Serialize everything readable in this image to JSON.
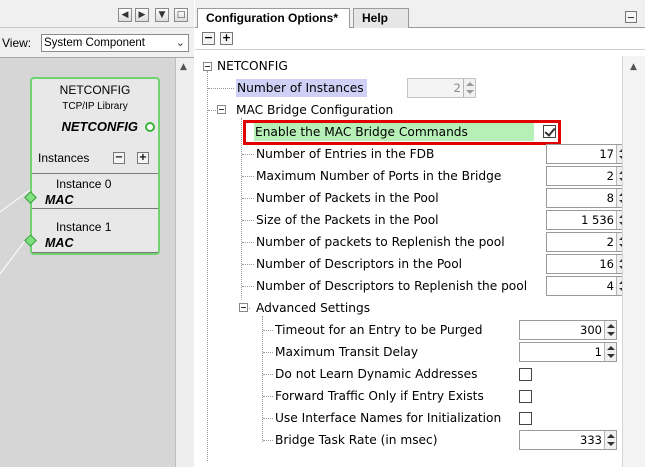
{
  "view": {
    "label": "View:",
    "selected": "System Component"
  },
  "component": {
    "title": "NETCONFIG",
    "subtitle": "TCP/IP Library",
    "name": "NETCONFIG",
    "instances_label": "Instances",
    "instances": [
      {
        "title": "Instance 0",
        "port": "MAC"
      },
      {
        "title": "Instance 1",
        "port": "MAC"
      }
    ]
  },
  "tabs": {
    "config": "Configuration Options*",
    "help": "Help"
  },
  "tree": {
    "root": "NETCONFIG",
    "num_instances": {
      "label": "Number of Instances",
      "value": "2"
    },
    "mac_bridge": {
      "label": "MAC Bridge Configuration",
      "enable": {
        "label": "Enable the MAC Bridge Commands",
        "checked": true
      },
      "fields": [
        {
          "label": "Number of Entries in the FDB",
          "value": "17"
        },
        {
          "label": "Maximum Number of Ports in the Bridge",
          "value": "2"
        },
        {
          "label": "Number of Packets in the Pool",
          "value": "8"
        },
        {
          "label": "Size of the Packets in the Pool",
          "value": "1 536"
        },
        {
          "label": "Number of packets to Replenish the pool",
          "value": "2"
        },
        {
          "label": "Number of Descriptors in the Pool",
          "value": "16"
        },
        {
          "label": "Number of Descriptors to Replenish the pool",
          "value": "4"
        }
      ],
      "advanced": {
        "label": "Advanced Settings",
        "timeout": {
          "label": "Timeout for an Entry to be Purged",
          "value": "300"
        },
        "max_transit": {
          "label": "Maximum Transit Delay",
          "value": "1"
        },
        "no_learn": {
          "label": "Do not Learn Dynamic Addresses",
          "checked": false
        },
        "forward_only": {
          "label": "Forward Traffic Only if Entry Exists",
          "checked": false
        },
        "use_names": {
          "label": "Use Interface Names for Initialization",
          "checked": false
        },
        "task_rate": {
          "label": "Bridge Task Rate (in msec)",
          "value": "333"
        }
      }
    }
  },
  "colors": {
    "highlight_blue": "#cfd0f5",
    "highlight_green": "#b7f0b7",
    "callout_red": "#e00000",
    "component_border": "#6fd46f"
  }
}
